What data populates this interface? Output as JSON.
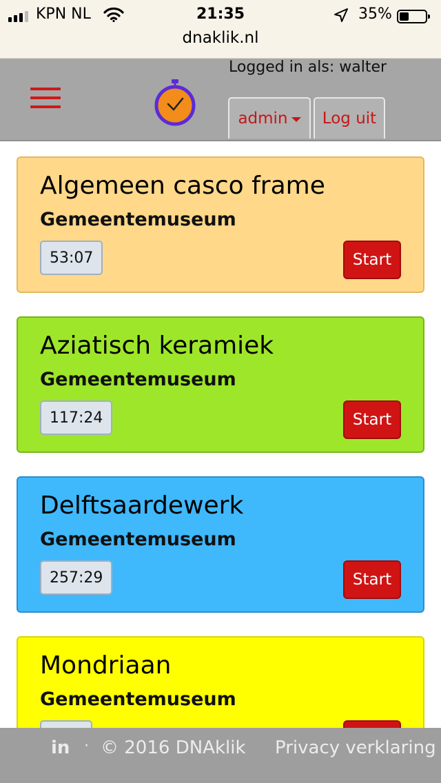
{
  "status_bar": {
    "carrier": "KPN NL",
    "time": "21:35",
    "battery": "35%",
    "battery_level": 0.35,
    "url": "dnaklik.nl"
  },
  "header": {
    "logged_in": "Logged in als: walter",
    "admin_label": "admin",
    "logout_label": "Log uit"
  },
  "cards": [
    {
      "title": "Algemeen casco frame",
      "subtitle": "Gemeentemuseum",
      "timer": "53:07",
      "start_label": "Start",
      "color": "#ffd88a",
      "border": "#e2b85c"
    },
    {
      "title": "Aziatisch keramiek",
      "subtitle": "Gemeentemuseum",
      "timer": "117:24",
      "start_label": "Start",
      "color": "#9ee62a",
      "border": "#79b51a"
    },
    {
      "title": "Delftsaardewerk",
      "subtitle": "Gemeentemuseum",
      "timer": "257:29",
      "start_label": "Start",
      "color": "#40b8fc",
      "border": "#2b8fcc"
    },
    {
      "title": "Mondriaan",
      "subtitle": "Gemeentemuseum",
      "timer": "",
      "start_label": "",
      "color": "#ffff00",
      "border": "#d6d600"
    }
  ],
  "footer": {
    "linkedin": "in",
    "separator": "·",
    "copyright": "© 2016 DNAklik",
    "privacy": "Privacy verklaring"
  },
  "icons": {
    "menu": "hamburger-menu-icon",
    "logo": "stopwatch-logo-icon",
    "location": "location-arrow-icon",
    "wifi": "wifi-icon"
  }
}
